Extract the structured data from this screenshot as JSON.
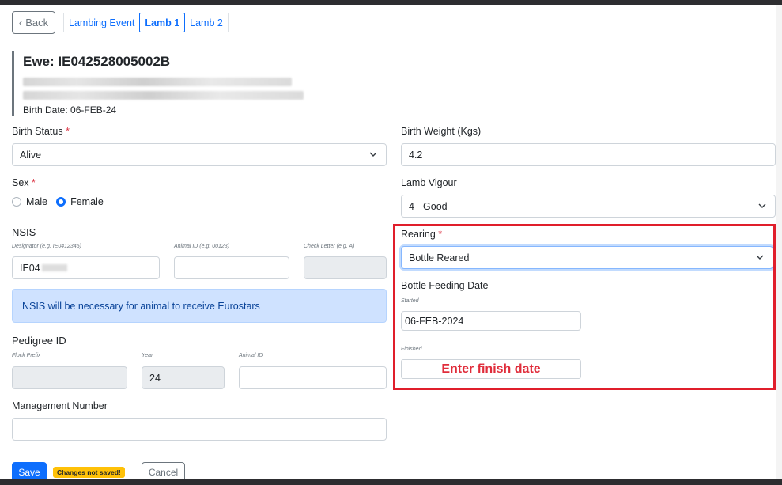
{
  "nav": {
    "back_label": "Back",
    "tabs": [
      {
        "label": "Lambing Event"
      },
      {
        "label": "Lamb 1"
      },
      {
        "label": "Lamb 2"
      }
    ]
  },
  "ewe": {
    "title": "Ewe: IE042528005002B",
    "birth_date": "Birth Date: 06-FEB-24"
  },
  "form": {
    "birth_status": {
      "label": "Birth Status",
      "required_mark": "*",
      "value": "Alive"
    },
    "birth_weight": {
      "label": "Birth Weight (Kgs)",
      "value": "4.2"
    },
    "sex": {
      "label": "Sex",
      "required_mark": "*",
      "options": [
        "Male",
        "Female"
      ],
      "selected": "Female"
    },
    "lamb_vigour": {
      "label": "Lamb Vigour",
      "value": "4 - Good"
    },
    "nsis": {
      "heading": "NSIS",
      "designator_label": "Designator (e.g. IE0412345)",
      "designator_value": "IE04",
      "animal_id_label": "Animal ID (e.g. 00123)",
      "animal_id_value": "",
      "check_letter_label": "Check Letter (e.g. A)",
      "check_letter_value": ""
    },
    "nsis_alert": "NSIS will be necessary for animal to receive Eurostars",
    "rearing": {
      "label": "Rearing",
      "required_mark": "*",
      "value": "Bottle Reared"
    },
    "bottle_feeding": {
      "heading": "Bottle Feeding Date",
      "started_label": "Started",
      "started_value": "06-FEB-2024",
      "finished_label": "Finished",
      "finished_annotation": "Enter finish date"
    },
    "pedigree": {
      "heading": "Pedigree ID",
      "flock_prefix_label": "Flock Prefix",
      "flock_prefix_value": "",
      "year_label": "Year",
      "year_value": "24",
      "animal_id_label": "Animal ID",
      "animal_id_value": ""
    },
    "management_number": {
      "label": "Management Number",
      "value": ""
    }
  },
  "actions": {
    "save_label": "Save",
    "unsaved_badge": "Changes not saved!",
    "cancel_label": "Cancel"
  },
  "colors": {
    "primary": "#0d6efd",
    "annotation_red": "#e01e2b",
    "warning": "#ffc107",
    "alert_bg": "#cfe2ff"
  }
}
